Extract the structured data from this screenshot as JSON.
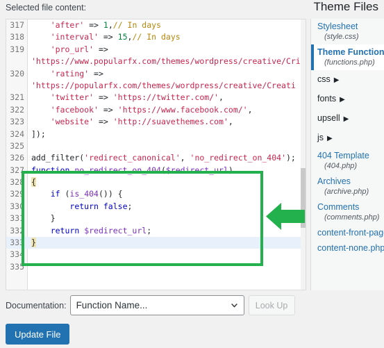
{
  "header": {
    "file_content_label": "Selected file content:",
    "theme_files_title": "Theme Files"
  },
  "editor": {
    "first_line_number": 317,
    "active_line_number": 333,
    "lines": [
      {
        "number": "317",
        "segments": [
          {
            "text": "    ",
            "type": "plain"
          },
          {
            "text": "'after'",
            "type": "string"
          },
          {
            "text": " => ",
            "type": "op"
          },
          {
            "text": "1",
            "type": "number"
          },
          {
            "text": ",",
            "type": "op"
          },
          {
            "text": "// In days",
            "type": "comment"
          }
        ]
      },
      {
        "number": "318",
        "segments": [
          {
            "text": "    ",
            "type": "plain"
          },
          {
            "text": "'interval'",
            "type": "string"
          },
          {
            "text": " => ",
            "type": "op"
          },
          {
            "text": "15",
            "type": "number"
          },
          {
            "text": ",",
            "type": "op"
          },
          {
            "text": "// In days",
            "type": "comment"
          }
        ]
      },
      {
        "number": "319",
        "segments": [
          {
            "text": "    ",
            "type": "plain"
          },
          {
            "text": "'pro_url'",
            "type": "string"
          },
          {
            "text": " =>",
            "type": "op"
          }
        ]
      },
      {
        "number": "",
        "segments": [
          {
            "text": "'https://www.popularfx.com/themes/wordpress/creative/Cri",
            "type": "string"
          }
        ]
      },
      {
        "number": "320",
        "segments": [
          {
            "text": "    ",
            "type": "plain"
          },
          {
            "text": "'rating'",
            "type": "string"
          },
          {
            "text": " =>",
            "type": "op"
          }
        ]
      },
      {
        "number": "",
        "segments": [
          {
            "text": "'https://popularfx.com/themes/wordpress/creative/Creati",
            "type": "string"
          }
        ]
      },
      {
        "number": "321",
        "segments": [
          {
            "text": "    ",
            "type": "plain"
          },
          {
            "text": "'twitter'",
            "type": "string"
          },
          {
            "text": " => ",
            "type": "op"
          },
          {
            "text": "'https://twitter.com/'",
            "type": "string"
          },
          {
            "text": ",",
            "type": "op"
          }
        ]
      },
      {
        "number": "322",
        "segments": [
          {
            "text": "    ",
            "type": "plain"
          },
          {
            "text": "'facebook'",
            "type": "string"
          },
          {
            "text": " => ",
            "type": "op"
          },
          {
            "text": "'https://www.facebook.com/'",
            "type": "string"
          },
          {
            "text": ",",
            "type": "op"
          }
        ]
      },
      {
        "number": "323",
        "segments": [
          {
            "text": "    ",
            "type": "plain"
          },
          {
            "text": "'website'",
            "type": "string"
          },
          {
            "text": " => ",
            "type": "op"
          },
          {
            "text": "'http://suavethemes.com'",
            "type": "string"
          },
          {
            "text": ",",
            "type": "op"
          }
        ]
      },
      {
        "number": "324",
        "segments": [
          {
            "text": "]);",
            "type": "plain"
          }
        ]
      },
      {
        "number": "325",
        "segments": []
      },
      {
        "number": "326",
        "segments": [
          {
            "text": "add_filter(",
            "type": "plain"
          },
          {
            "text": "'redirect_canonical'",
            "type": "string"
          },
          {
            "text": ", ",
            "type": "op"
          },
          {
            "text": "'no_redirect_on_404'",
            "type": "string"
          },
          {
            "text": ");",
            "type": "op"
          }
        ]
      },
      {
        "number": "327",
        "segments": [
          {
            "text": "function ",
            "type": "keyword"
          },
          {
            "text": "no_redirect_on_404",
            "type": "function"
          },
          {
            "text": "(",
            "type": "op"
          },
          {
            "text": "$redirect_url",
            "type": "variable"
          },
          {
            "text": ")",
            "type": "op"
          }
        ]
      },
      {
        "number": "328",
        "segments": [
          {
            "text": "{",
            "type": "brace-match"
          }
        ]
      },
      {
        "number": "329",
        "segments": [
          {
            "text": "    ",
            "type": "plain"
          },
          {
            "text": "if",
            "type": "keyword"
          },
          {
            "text": " (",
            "type": "op"
          },
          {
            "text": "is_404",
            "type": "function"
          },
          {
            "text": "()) {",
            "type": "op"
          }
        ]
      },
      {
        "number": "330",
        "segments": [
          {
            "text": "        ",
            "type": "plain"
          },
          {
            "text": "return",
            "type": "keyword"
          },
          {
            "text": " ",
            "type": "op"
          },
          {
            "text": "false",
            "type": "keyword"
          },
          {
            "text": ";",
            "type": "op"
          }
        ]
      },
      {
        "number": "331",
        "segments": [
          {
            "text": "    }",
            "type": "plain"
          }
        ]
      },
      {
        "number": "332",
        "segments": [
          {
            "text": "    ",
            "type": "plain"
          },
          {
            "text": "return",
            "type": "keyword"
          },
          {
            "text": " ",
            "type": "op"
          },
          {
            "text": "$redirect_url",
            "type": "variable"
          },
          {
            "text": ";",
            "type": "op"
          }
        ]
      },
      {
        "number": "333",
        "segments": [
          {
            "text": "}",
            "type": "brace-match"
          }
        ]
      },
      {
        "number": "334",
        "segments": []
      },
      {
        "number": "335",
        "segments": []
      }
    ]
  },
  "sidebar": {
    "items": [
      {
        "kind": "file",
        "name": "Stylesheet",
        "sub": "(style.css)",
        "selected": false
      },
      {
        "kind": "file",
        "name": "Theme Functions",
        "sub": "(functions.php)",
        "selected": true
      },
      {
        "kind": "folder",
        "name": "css",
        "arrow": "▶"
      },
      {
        "kind": "folder",
        "name": "fonts",
        "arrow": "▶"
      },
      {
        "kind": "folder",
        "name": "upsell",
        "arrow": "▶"
      },
      {
        "kind": "folder",
        "name": "js",
        "arrow": "▶"
      },
      {
        "kind": "file",
        "name": "404 Template",
        "sub": "(404.php)",
        "selected": false
      },
      {
        "kind": "file",
        "name": "Archives",
        "sub": "(archive.php)",
        "selected": false
      },
      {
        "kind": "file",
        "name": "Comments",
        "sub": "(comments.php)",
        "selected": false
      },
      {
        "kind": "file",
        "name": "content-front-page.php",
        "sub": "",
        "selected": false
      },
      {
        "kind": "file",
        "name": "content-none.php",
        "sub": "",
        "selected": false
      }
    ]
  },
  "footer": {
    "documentation_label": "Documentation:",
    "function_select_value": "Function Name...",
    "look_up_label": "Look Up",
    "update_file_label": "Update File"
  },
  "annotations": {
    "highlight_color": "#22b14c",
    "box_target": "function no_redirect_on_404 block (lines 327-333)",
    "arrow_direction": "left"
  }
}
